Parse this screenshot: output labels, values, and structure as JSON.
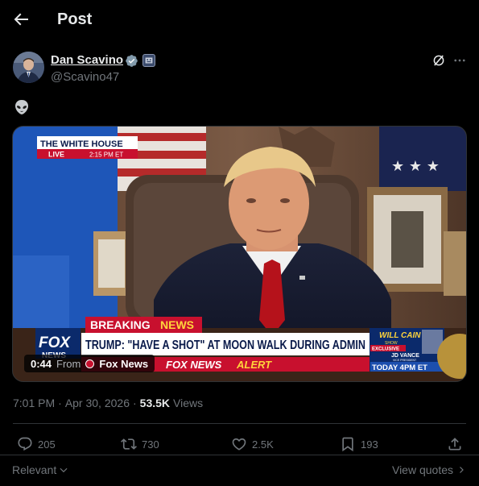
{
  "header": {
    "title": "Post"
  },
  "author": {
    "name": "Dan Scavino",
    "handle": "@Scavino47"
  },
  "post": {
    "text": "👽",
    "video": {
      "duration": "0:44",
      "source_prefix": "From",
      "source_name": "Fox News",
      "bug_title": "THE WHITE HOUSE",
      "bug_live": "LIVE",
      "bug_time": "2:15 PM ET",
      "breaking_label": "BREAKING",
      "breaking_news": "NEWS",
      "headline": "TRUMP: \"HAVE A SHOT\" AT MOON WALK DURING ADMIN",
      "alert_brand": "FOX NEWS",
      "alert_word": "ALERT",
      "network_logo": "FOX",
      "network_logo_sub": "NEWS",
      "promo_show": "WILL CAIN",
      "promo_show_sub": "SHOW",
      "promo_exclusive": "EXCLUSIVE",
      "promo_guest": "JD VANCE",
      "promo_guest_title": "VICE PRESIDENT",
      "promo_time": "TODAY 4PM ET"
    }
  },
  "meta": {
    "time": "7:01 PM",
    "separator": "·",
    "date": "Apr 30, 2026",
    "views_count": "53.5K",
    "views_label": "Views"
  },
  "actions": {
    "replies": "205",
    "reposts": "730",
    "likes": "2.5K",
    "bookmarks": "193"
  },
  "footer": {
    "sort_label": "Relevant",
    "view_quotes": "View quotes"
  },
  "colors": {
    "background": "#000000",
    "text": "#e7e9ea",
    "muted": "#71767b",
    "verified": "#829aab",
    "divider": "#2f3336",
    "alert_red": "#c8102e"
  }
}
